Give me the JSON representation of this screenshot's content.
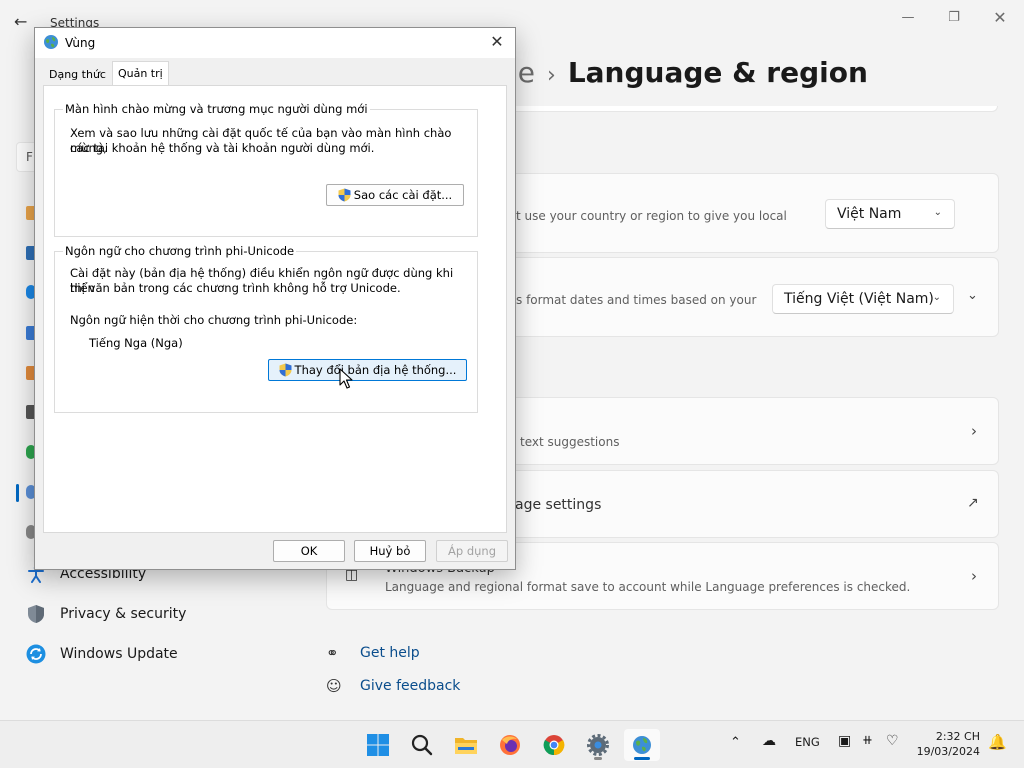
{
  "settings": {
    "app_title": "Settings",
    "breadcrumb_partial": "ge",
    "page_title": "Language & region",
    "search_placeholder_partial": "F",
    "nav": {
      "accessibility": "Accessibility",
      "privacy": "Privacy & security",
      "windows_update": "Windows Update"
    },
    "country_card": {
      "desc_partial": "t use your country or region to give you local",
      "value": "Việt Nam"
    },
    "format_card": {
      "desc_partial": "s format dates and times based on your",
      "value": "Tiếng Việt (Việt Nam)"
    },
    "typing_card": {
      "desc_partial": "text suggestions"
    },
    "admin_card": {
      "title_partial": "age settings"
    },
    "backup_card": {
      "title_partial": "Windows Backup",
      "desc": "Language and regional format save to account while Language preferences is checked."
    },
    "links": {
      "get_help": "Get help",
      "give_feedback": "Give feedback"
    }
  },
  "dialog": {
    "title": "Vùng",
    "tabs": [
      "Dạng thức",
      "Quản trị"
    ],
    "active_tab": 1,
    "welcome_group": {
      "legend": "Màn hình chào mừng và trương mục người dùng mới",
      "description_line1": "Xem và sao lưu những cài đặt quốc tế của bạn vào màn hình chào mừng,",
      "description_line2": "các tài khoản hệ thống và tài khoản người dùng mới.",
      "button": "Sao các cài đặt..."
    },
    "unicode_group": {
      "legend": "Ngôn ngữ cho chương trình phi-Unicode",
      "description_line1": "Cài đặt này (bản địa hệ thống) điều khiển ngôn ngữ được dùng khi hiển",
      "description_line2": "thị văn bản trong các chương trình không hỗ trợ Unicode.",
      "current_label": "Ngôn ngữ hiện thời cho chương trình phi-Unicode:",
      "current_value": "Tiếng Nga (Nga)",
      "button": "Thay đổi bản địa hệ thống..."
    },
    "buttons": {
      "ok": "OK",
      "cancel": "Huỷ bỏ",
      "apply": "Áp dụng"
    }
  },
  "taskbar": {
    "language": "ENG",
    "time": "2:32 CH",
    "date": "19/03/2024"
  },
  "colors": {
    "accent": "#0067c0",
    "link": "#0a4d8c",
    "button_hot": "#e5f1fb",
    "button_hot_border": "#0078d7"
  }
}
